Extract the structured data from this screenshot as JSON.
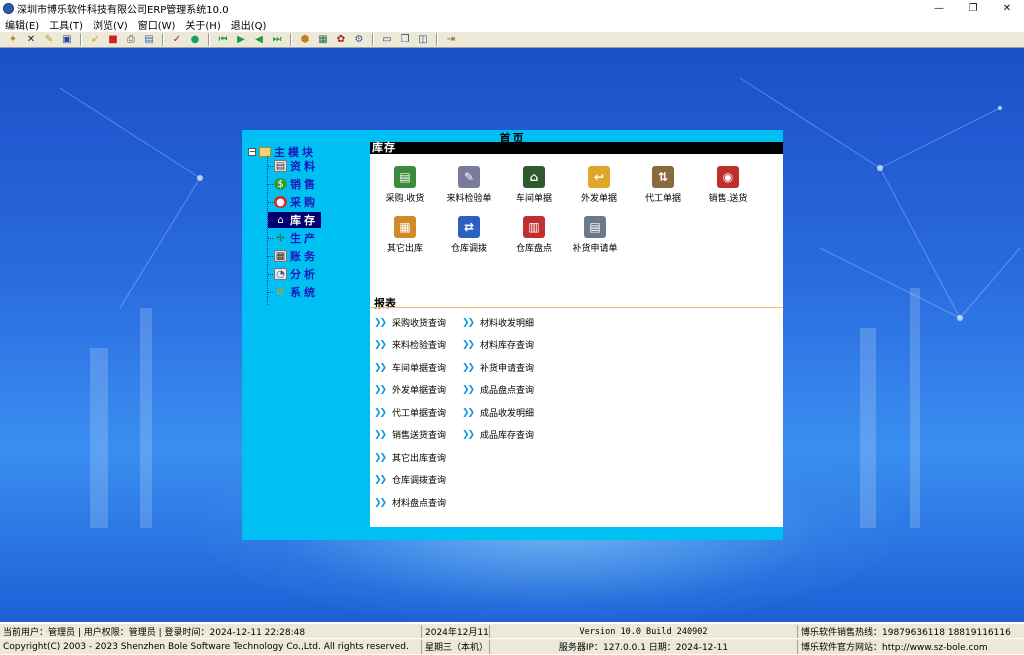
{
  "window": {
    "title": "深圳市博乐软件科技有限公司ERP管理系统10.0",
    "controls": {
      "minimize": "—",
      "restore": "❐",
      "close": "✕"
    }
  },
  "menu": [
    "编辑(E)",
    "工具(T)",
    "浏览(V)",
    "窗口(W)",
    "关于(H)",
    "退出(Q)"
  ],
  "toolbar": {
    "icons": [
      "wizard-icon",
      "delete-icon",
      "edit-icon",
      "save-icon",
      "approve-icon",
      "stop-icon",
      "print-icon",
      "print-preview-icon",
      "check-icon",
      "refresh-icon",
      "first-icon",
      "next-icon",
      "previous-icon",
      "last-icon",
      "export-icon",
      "calculator-icon",
      "report-icon",
      "settings-icon",
      "window-tile-icon",
      "window-cascade-icon",
      "window-split-icon",
      "exit-icon"
    ]
  },
  "panel": {
    "title": "首页",
    "tree": {
      "root": "主模块",
      "items": [
        {
          "label": "资料",
          "icon": "data-icon",
          "color": "#e9e9e9",
          "selected": false
        },
        {
          "label": "销售",
          "icon": "sales-icon",
          "color": "#2e9b3a",
          "selected": false
        },
        {
          "label": "采购",
          "icon": "purchase-icon",
          "color": "#d22a2a",
          "selected": false
        },
        {
          "label": "库存",
          "icon": "warehouse-icon",
          "color": "#ffffff",
          "selected": true
        },
        {
          "label": "生产",
          "icon": "production-icon",
          "color": "#3fae4e",
          "selected": false
        },
        {
          "label": "账务",
          "icon": "accounting-icon",
          "color": "#dcdcdc",
          "selected": false
        },
        {
          "label": "分析",
          "icon": "analysis-icon",
          "color": "#e8e8e8",
          "selected": false
        },
        {
          "label": "系统",
          "icon": "system-icon",
          "color": "#e9b72b",
          "selected": false
        }
      ]
    },
    "section_inventory": "库存",
    "inventory_items": [
      {
        "label": "采购.收货",
        "icon": "purchase-receipt-icon",
        "color": "#3c8a3c",
        "glyph": "▤"
      },
      {
        "label": "来料检验单",
        "icon": "incoming-inspection-icon",
        "color": "#7a7a9a",
        "glyph": "✎"
      },
      {
        "label": "车间单据",
        "icon": "workshop-doc-icon",
        "color": "#2e5a2e",
        "glyph": "⌂"
      },
      {
        "label": "外发单据",
        "icon": "outsource-doc-icon",
        "color": "#e0a52a",
        "glyph": "↩"
      },
      {
        "label": "代工单据",
        "icon": "oem-doc-icon",
        "color": "#8a6a3a",
        "glyph": "⇅"
      },
      {
        "label": "销售.送货",
        "icon": "sales-delivery-icon",
        "color": "#c0302a",
        "glyph": "◉"
      },
      {
        "label": "其它出库",
        "icon": "other-outbound-icon",
        "color": "#d08a2a",
        "glyph": "▦"
      },
      {
        "label": "仓库调拨",
        "icon": "warehouse-transfer-icon",
        "color": "#2a60c0",
        "glyph": "⇄"
      },
      {
        "label": "仓库盘点",
        "icon": "warehouse-count-icon",
        "color": "#c03030",
        "glyph": "▥"
      },
      {
        "label": "补货申请单",
        "icon": "replenish-request-icon",
        "color": "#6a7a8a",
        "glyph": "▤"
      }
    ],
    "section_reports": "报表",
    "reports_col1": [
      "采购收货查询",
      "来料检验查询",
      "车间单据查询",
      "外发单据查询",
      "代工单据查询",
      "销售送货查询",
      "其它出库查询",
      "仓库调拨查询",
      "材料盘点查询"
    ],
    "reports_col2": [
      "材料收发明细",
      "材料库存查询",
      "补货申请查询",
      "成品盘点查询",
      "成品收发明细",
      "成品库存查询"
    ],
    "link_arrow": "❯❯"
  },
  "status": {
    "user_info": "当前用户：管理员 | 用户权限：管理员 | 登录时间：2024-12-11 22:28:48",
    "date": "2024年12月11日",
    "version": "Version 10.0 Build 240902",
    "hotline": "博乐软件销售热线：19879636118 18819116116",
    "copyright": "Copyright(C) 2003 - 2023 Shenzhen Bole Software Technology Co.,Ltd. All rights reserved.",
    "weekday": "星期三（本机）",
    "server": "服务器IP：127.0.0.1 日期：2024-12-11",
    "website": "博乐软件官方网站：http://www.sz-bole.com"
  }
}
